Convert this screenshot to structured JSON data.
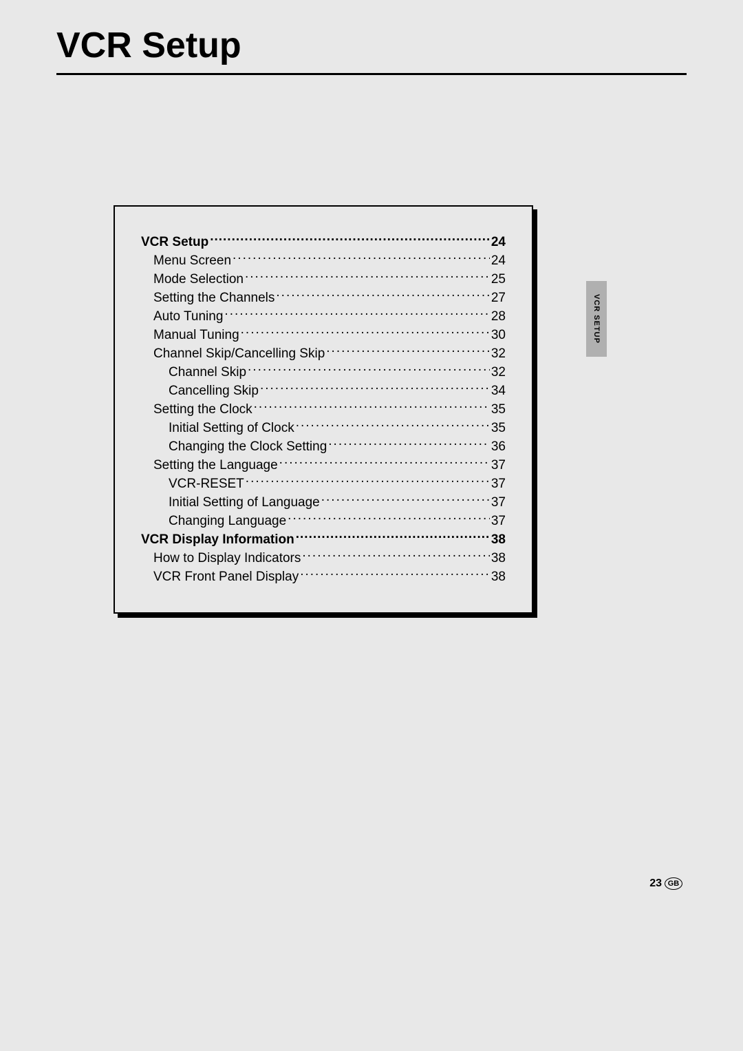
{
  "title": "VCR Setup",
  "sideTab": "VCR SETUP",
  "footer": {
    "pageNumber": "23",
    "region": "GB"
  },
  "toc": [
    {
      "label": "VCR Setup",
      "page": "24",
      "bold": true,
      "indent": 0
    },
    {
      "label": "Menu Screen",
      "page": "24",
      "bold": false,
      "indent": 1
    },
    {
      "label": "Mode Selection",
      "page": "25",
      "bold": false,
      "indent": 1
    },
    {
      "label": "Setting the Channels",
      "page": "27",
      "bold": false,
      "indent": 1
    },
    {
      "label": "Auto Tuning",
      "page": "28",
      "bold": false,
      "indent": 1
    },
    {
      "label": "Manual Tuning",
      "page": "30",
      "bold": false,
      "indent": 1
    },
    {
      "label": "Channel Skip/Cancelling Skip",
      "page": "32",
      "bold": false,
      "indent": 1
    },
    {
      "label": "Channel Skip",
      "page": "32",
      "bold": false,
      "indent": 2
    },
    {
      "label": "Cancelling Skip",
      "page": "34",
      "bold": false,
      "indent": 2
    },
    {
      "label": "Setting the Clock",
      "page": "35",
      "bold": false,
      "indent": 1
    },
    {
      "label": "Initial Setting of Clock",
      "page": "35",
      "bold": false,
      "indent": 2
    },
    {
      "label": "Changing the Clock Setting",
      "page": "36",
      "bold": false,
      "indent": 2
    },
    {
      "label": "Setting the Language",
      "page": "37",
      "bold": false,
      "indent": 1
    },
    {
      "label": "VCR-RESET",
      "page": "37",
      "bold": false,
      "indent": 2
    },
    {
      "label": "Initial Setting of Language",
      "page": "37",
      "bold": false,
      "indent": 2
    },
    {
      "label": "Changing Language",
      "page": "37",
      "bold": false,
      "indent": 2
    },
    {
      "label": "VCR Display Information",
      "page": "38",
      "bold": true,
      "indent": 0
    },
    {
      "label": "How to Display Indicators",
      "page": "38",
      "bold": false,
      "indent": 1
    },
    {
      "label": "VCR Front Panel Display",
      "page": "38",
      "bold": false,
      "indent": 1
    }
  ]
}
